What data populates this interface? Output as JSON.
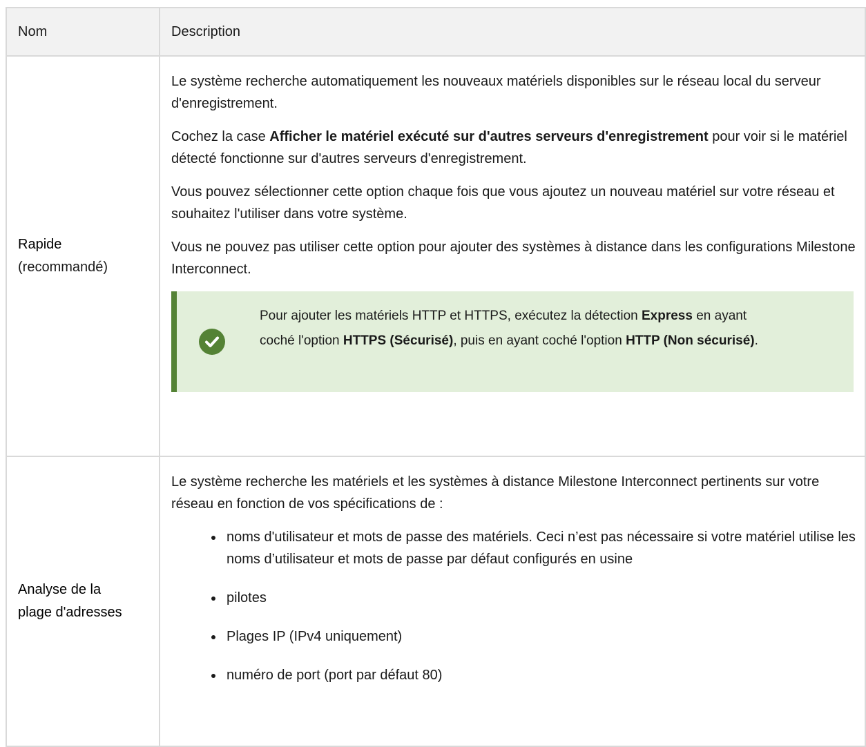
{
  "header": {
    "col_name": "Nom",
    "col_description": "Description"
  },
  "rows": [
    {
      "name_main": "Rapide",
      "name_sub": "(recommandé)",
      "para1": "Le système recherche automatiquement les nouveaux matériels disponibles sur le réseau local du serveur d'enregistrement.",
      "para2_pre": "Cochez la case ",
      "para2_bold": "Afficher le matériel exécuté sur d'autres serveurs d'enregistrement",
      "para2_post": " pour voir si le matériel détecté fonctionne sur d'autres serveurs d'enregistrement.",
      "para3": "Vous pouvez sélectionner cette option chaque fois que vous ajoutez un nouveau matériel sur votre réseau et souhaitez l'utiliser dans votre système.",
      "para4": "Vous ne pouvez pas utiliser cette option pour ajouter des systèmes à distance dans les configurations Milestone Interconnect.",
      "note": {
        "icon": "checkmark-circle-icon",
        "part1": "Pour ajouter les matériels HTTP et HTTPS, exécutez la détection ",
        "bold1": "Express",
        "part2": " en ayant coché l'option ",
        "bold2": "HTTPS (Sécurisé)",
        "part3": ", puis en ayant coché l'option ",
        "bold3": "HTTP (Non sécurisé)",
        "part4": "."
      }
    },
    {
      "name_line1": "Analyse de la",
      "name_line2": "plage d'adresses",
      "para1": "Le système recherche les matériels et les systèmes à distance Milestone Interconnect pertinents sur votre réseau en fonction de vos spécifications de :",
      "bullets": [
        "noms d'utilisateur et mots de passe des matériels. Ceci n’est pas nécessaire si votre matériel utilise les noms d’utilisateur et mots de passe par défaut configurés en usine",
        "pilotes",
        "Plages IP (IPv4 uniquement)",
        "numéro de port (port par défaut 80)"
      ]
    }
  ],
  "colors": {
    "note_bg": "#e2efda",
    "note_accent": "#548235",
    "header_bg": "#f2f2f2",
    "border": "#d9d9d9"
  }
}
